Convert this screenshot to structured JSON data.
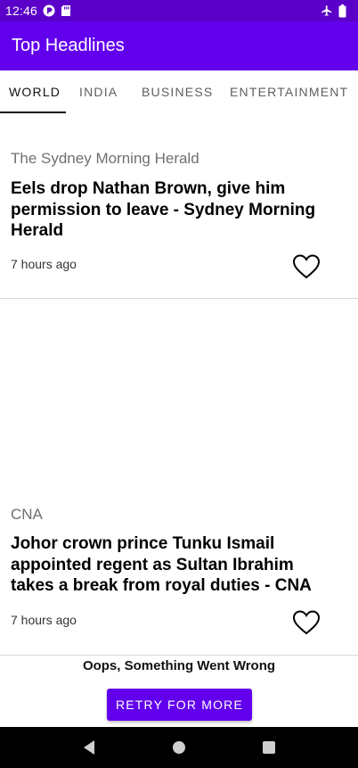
{
  "status_bar": {
    "time": "12:46",
    "icons_left": [
      "data-saver-icon",
      "sd-card-icon"
    ],
    "icons_right": [
      "airplane-mode-icon",
      "battery-icon"
    ]
  },
  "app_bar": {
    "title": "Top Headlines",
    "color": "#6200ee"
  },
  "tabs": [
    {
      "label": "WORLD",
      "active": true
    },
    {
      "label": "INDIA",
      "active": false
    },
    {
      "label": "BUSINESS",
      "active": false
    },
    {
      "label": "ENTERTAINMENT",
      "active": false
    }
  ],
  "articles": [
    {
      "source": "The Sydney Morning Herald",
      "headline": "Eels drop Nathan Brown, give him permission to leave - Sydney Morning Herald",
      "time": "7 hours ago",
      "favorite": false
    },
    {
      "source": "CNA",
      "headline": "Johor crown prince Tunku Ismail appointed regent as Sultan Ibrahim takes a break from royal duties - CNA",
      "time": "7 hours ago",
      "favorite": false
    }
  ],
  "error": {
    "message": "Oops, Something Went Wrong",
    "retry_label": "RETRY FOR MORE"
  },
  "nav_bar": {
    "buttons": [
      "back-icon",
      "home-icon",
      "recents-icon"
    ]
  }
}
